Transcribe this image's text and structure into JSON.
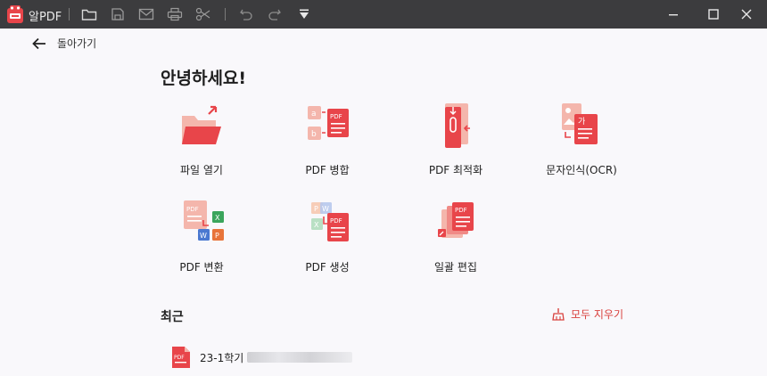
{
  "app": {
    "name": "알PDF",
    "logo": "alpdf-logo-icon"
  },
  "toolbar": {
    "icons": [
      "folder-icon",
      "save-icon",
      "mail-icon",
      "print-icon",
      "scissors-icon",
      "undo-icon",
      "redo-icon",
      "dropdown-menu-icon"
    ]
  },
  "window": {
    "controls": [
      "minimize-icon",
      "maximize-icon",
      "close-icon"
    ]
  },
  "nav": {
    "back_label": "돌아가기"
  },
  "home": {
    "greeting": "안녕하세요!",
    "tiles": [
      {
        "label": "파일 열기",
        "icon": "open-folder-icon"
      },
      {
        "label": "PDF 병합",
        "icon": "merge-pdf-icon"
      },
      {
        "label": "PDF 최적화",
        "icon": "compress-pdf-icon"
      },
      {
        "label": "문자인식(OCR)",
        "icon": "ocr-icon"
      },
      {
        "label": "PDF 변환",
        "icon": "convert-pdf-icon"
      },
      {
        "label": "PDF 생성",
        "icon": "create-pdf-icon"
      },
      {
        "label": "일괄 편집",
        "icon": "batch-edit-icon"
      }
    ]
  },
  "recent": {
    "title": "최근",
    "clear_label": "모두 지우기",
    "files": [
      {
        "name": "23-1학기",
        "icon": "pdf-file-icon"
      }
    ]
  },
  "colors": {
    "accent": "#e8454a",
    "titlebar": "#3c3c3e",
    "background": "#f9f8fb"
  }
}
